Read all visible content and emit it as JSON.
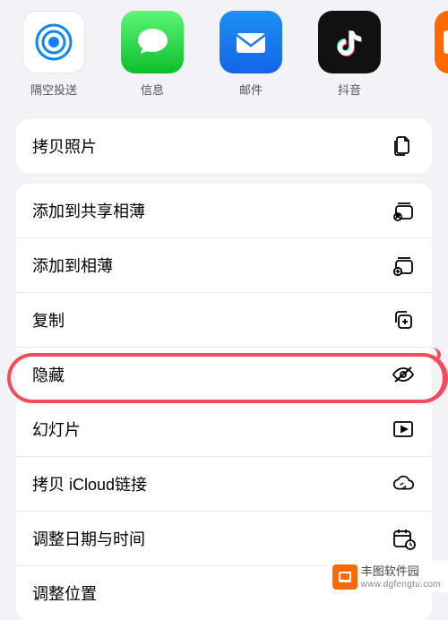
{
  "apps": {
    "airdrop": "隔空投送",
    "messages": "信息",
    "mail": "邮件",
    "douyin": "抖音"
  },
  "actions": {
    "copy_photo": "拷贝照片",
    "add_shared_album": "添加到共享相薄",
    "add_album": "添加到相薄",
    "duplicate": "复制",
    "hide": "隐藏",
    "slideshow": "幻灯片",
    "icloud_link": "拷贝 iCloud链接",
    "adjust_datetime": "调整日期与时间",
    "adjust_location": "调整位置"
  },
  "watermark": {
    "title": "丰图软件园",
    "url": "www.dgfengtu.com"
  }
}
